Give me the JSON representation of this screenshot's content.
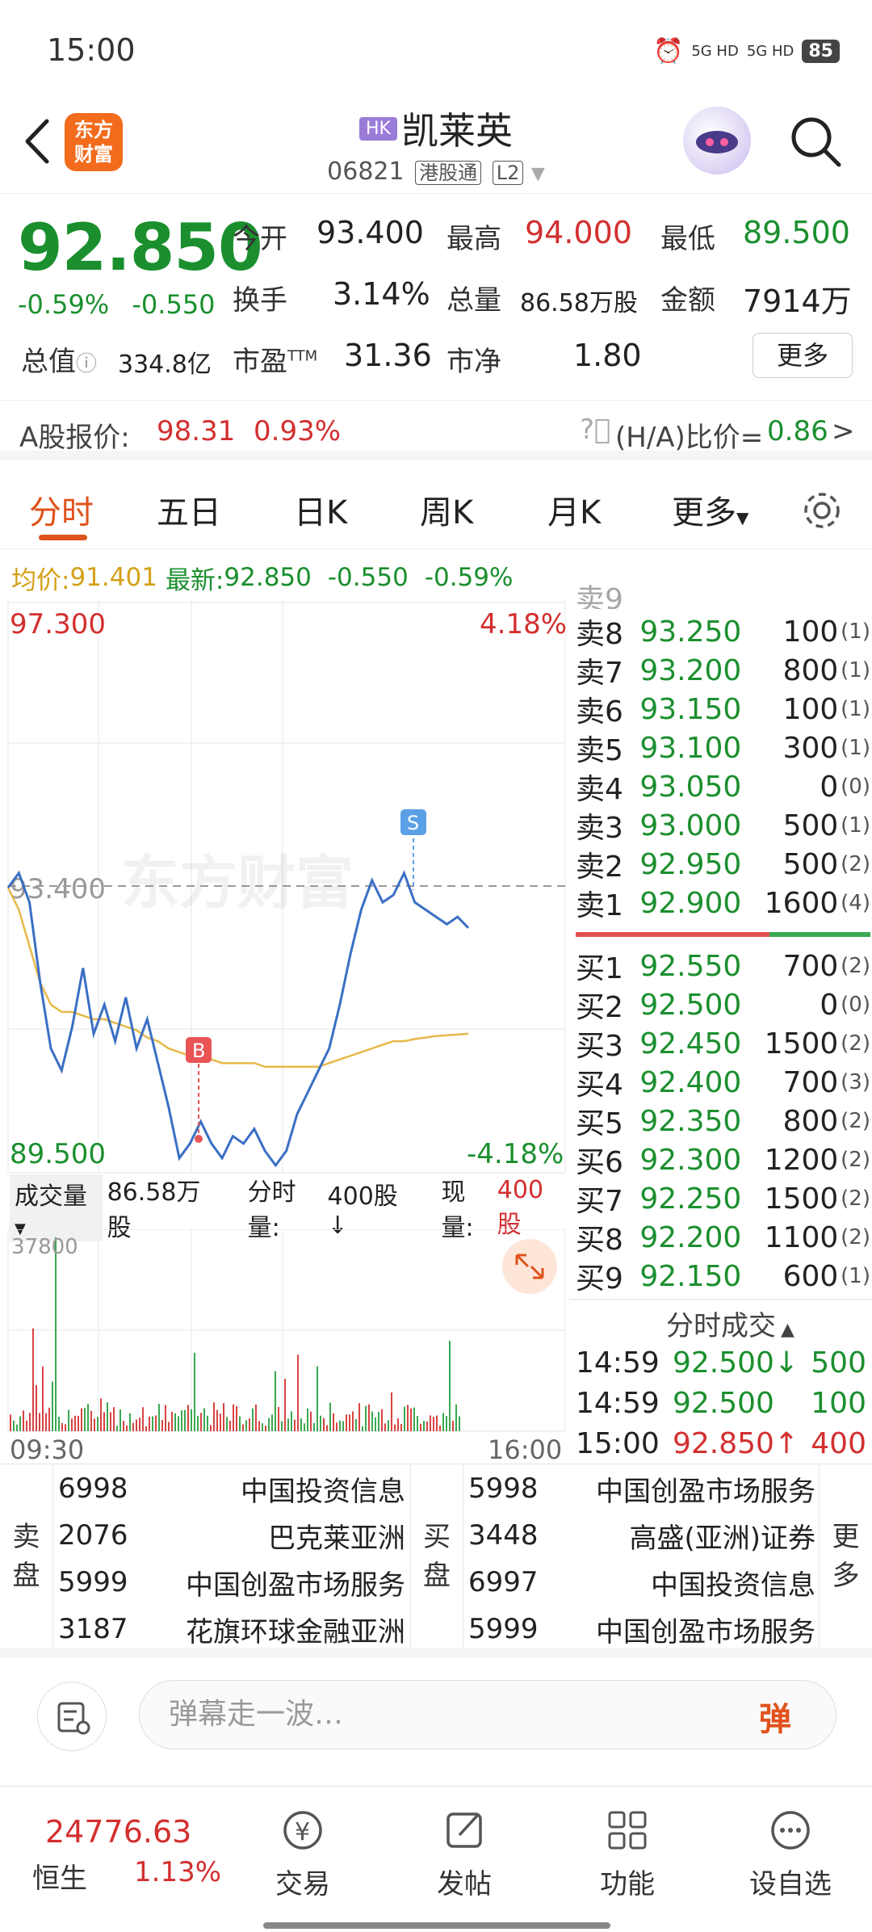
{
  "status": {
    "time": "15:00",
    "signal1": "5G HD",
    "signal2": "5G HD",
    "battery": "85"
  },
  "nav": {
    "logo_line1": "东方",
    "logo_line2": "财富",
    "market_badge": "HK",
    "title": "凯莱英",
    "code": "06821",
    "badge1": "港股通",
    "badge2": "L2"
  },
  "quote": {
    "price": "92.850",
    "change_pct": "-0.59%",
    "change": "-0.550",
    "open_label": "今开",
    "open": "93.400",
    "high_label": "最高",
    "high": "94.000",
    "low_label": "最低",
    "low": "89.500",
    "turnover_label": "换手",
    "turnover": "3.14%",
    "volume_label": "总量",
    "volume": "86.58万股",
    "amount_label": "金额",
    "amount": "7914万",
    "mktcap_label": "总值",
    "mktcap": "334.8亿",
    "pe_label": "市盈",
    "pe_sup": "TTM",
    "pe": "31.36",
    "pb_label": "市净",
    "pb": "1.80",
    "more": "更多"
  },
  "ashare": {
    "label": "A股报价:",
    "price": "98.31",
    "pct": "0.93%",
    "ratio_label": "(H/A)比价=",
    "ratio": "0.86",
    "arrow": ">"
  },
  "tabs": [
    "分时",
    "五日",
    "日K",
    "周K",
    "月K",
    "更多"
  ],
  "avg": {
    "avg_label": "均价:",
    "avg": "91.401",
    "last_label": "最新:",
    "last": "92.850",
    "chg": "-0.550",
    "pct": "-0.59%"
  },
  "chart_labels": {
    "top_price": "97.300",
    "top_pct": "4.18%",
    "bottom_price": "89.500",
    "bottom_pct": "-4.18%",
    "ref_price": "93.400",
    "watermark": "东方财富",
    "b_marker": "B",
    "s_marker": "S"
  },
  "chart_data": {
    "type": "line",
    "ylim": [
      89.5,
      97.3
    ],
    "reference": 93.4,
    "series": [
      {
        "name": "",
        "values": [
          93.4,
          93.6,
          93.2,
          92.1,
          91.2,
          90.9,
          91.5,
          92.3,
          91.4,
          91.8,
          91.3,
          91.9,
          91.2,
          91.6,
          91.0,
          90.4,
          89.7,
          89.9,
          90.2,
          89.9,
          89.7,
          90.0,
          89.9,
          90.1,
          89.8,
          89.6,
          89.8,
          90.3,
          90.6,
          90.9,
          91.2,
          91.8,
          92.5,
          93.1,
          93.5,
          93.2,
          93.3,
          93.6,
          93.2,
          93.1,
          93.0,
          92.9,
          93.0,
          92.85
        ]
      },
      {
        "name": "",
        "values": [
          93.4,
          93.1,
          92.6,
          92.1,
          91.8,
          91.7,
          91.7,
          91.65,
          91.6,
          91.6,
          91.55,
          91.5,
          91.45,
          91.35,
          91.3,
          91.2,
          91.15,
          91.1,
          91.1,
          91.05,
          91.0,
          91.0,
          91.0,
          91.0,
          90.95,
          90.95,
          90.95,
          90.95,
          90.95,
          90.95,
          91.0,
          91.05,
          91.1,
          91.15,
          91.2,
          91.25,
          91.3,
          91.3,
          91.33,
          91.35,
          91.37,
          91.38,
          91.39,
          91.401
        ]
      }
    ]
  },
  "volume": {
    "label": "成交量",
    "total": "86.58万股",
    "fen_label": "分时量:",
    "fen": "400股↓",
    "now_label": "现量:",
    "now": "400股",
    "max": "37800",
    "t_start": "09:30",
    "t_end": "16:00"
  },
  "book": {
    "asks": [
      {
        "label": "卖8",
        "price": "93.250",
        "qty": "100",
        "cnt": "(1)"
      },
      {
        "label": "卖7",
        "price": "93.200",
        "qty": "800",
        "cnt": "(1)"
      },
      {
        "label": "卖6",
        "price": "93.150",
        "qty": "100",
        "cnt": "(1)"
      },
      {
        "label": "卖5",
        "price": "93.100",
        "qty": "300",
        "cnt": "(1)"
      },
      {
        "label": "卖4",
        "price": "93.050",
        "qty": "0",
        "cnt": "(0)"
      },
      {
        "label": "卖3",
        "price": "93.000",
        "qty": "500",
        "cnt": "(1)"
      },
      {
        "label": "卖2",
        "price": "92.950",
        "qty": "500",
        "cnt": "(2)"
      },
      {
        "label": "卖1",
        "price": "92.900",
        "qty": "1600",
        "cnt": "(4)"
      }
    ],
    "bids": [
      {
        "label": "买1",
        "price": "92.550",
        "qty": "700",
        "cnt": "(2)"
      },
      {
        "label": "买2",
        "price": "92.500",
        "qty": "0",
        "cnt": "(0)"
      },
      {
        "label": "买3",
        "price": "92.450",
        "qty": "1500",
        "cnt": "(2)"
      },
      {
        "label": "买4",
        "price": "92.400",
        "qty": "700",
        "cnt": "(3)"
      },
      {
        "label": "买5",
        "price": "92.350",
        "qty": "800",
        "cnt": "(2)"
      },
      {
        "label": "买6",
        "price": "92.300",
        "qty": "1200",
        "cnt": "(2)"
      },
      {
        "label": "买7",
        "price": "92.250",
        "qty": "1500",
        "cnt": "(2)"
      },
      {
        "label": "买8",
        "price": "92.200",
        "qty": "1100",
        "cnt": "(2)"
      },
      {
        "label": "买9",
        "price": "92.150",
        "qty": "600",
        "cnt": "(1)"
      }
    ],
    "ticks_title": "分时成交",
    "ticks": [
      {
        "time": "14:59",
        "price": "92.500↓",
        "vol": "500",
        "color": "#1b8f2e"
      },
      {
        "time": "14:59",
        "price": "92.500",
        "vol": "100",
        "color": "#1b8f2e"
      },
      {
        "time": "15:00",
        "price": "92.850↑",
        "vol": "400",
        "color": "#d32f2f"
      }
    ]
  },
  "brokers": {
    "sell_label": "卖盘",
    "buy_label": "买盘",
    "more": "更多",
    "sell": [
      {
        "id": "6998",
        "name": "中国投资信息"
      },
      {
        "id": "2076",
        "name": "巴克莱亚洲"
      },
      {
        "id": "5999",
        "name": "中国创盈市场服务"
      },
      {
        "id": "3187",
        "name": "花旗环球金融亚洲"
      }
    ],
    "buy": [
      {
        "id": "5998",
        "name": "中国创盈市场服务"
      },
      {
        "id": "3448",
        "name": "高盛(亚洲)证券"
      },
      {
        "id": "6997",
        "name": "中国投资信息"
      },
      {
        "id": "5999",
        "name": "中国创盈市场服务"
      }
    ]
  },
  "comment": {
    "placeholder": "弹幕走一波…",
    "danmu": "弹"
  },
  "bottom": {
    "index_value": "24776.63",
    "index_name": "恒生",
    "index_pct": "1.13%",
    "trade": "交易",
    "post": "发帖",
    "func": "功能",
    "watch": "设自选"
  }
}
